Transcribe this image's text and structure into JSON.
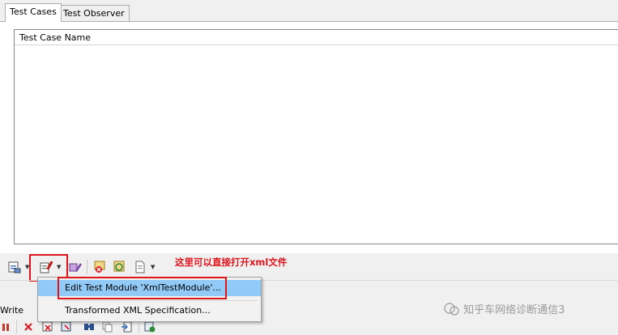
{
  "tabs": [
    {
      "label": "Test Cases",
      "active": true
    },
    {
      "label": "Test Observer",
      "active": false
    }
  ],
  "list": {
    "column_header": "Test Case Name"
  },
  "annotation": "这里可以直接打开xml文件",
  "context_menu": {
    "items": [
      {
        "label": "Edit Test Module 'XmlTestModule'...",
        "highlighted": true
      },
      {
        "label": "Transformed XML Specification...",
        "highlighted": false
      }
    ]
  },
  "bottom_panel": {
    "label": "Write"
  },
  "watermark": "知乎车网络诊断通信3",
  "colors": {
    "highlight": "#91c9f7",
    "annotation_red": "#e0151b",
    "border": "#828790"
  },
  "toolbar_icons": [
    "test-module-icon",
    "edit-xml-icon",
    "brush-icon",
    "error-report-icon",
    "refresh-report-icon",
    "document-icon"
  ],
  "bottom_toolbar_icons": [
    "pause-icon",
    "stop-icon",
    "delete-error-icon",
    "filter-icon",
    "find-icon",
    "copy-icon",
    "export-icon",
    "options-icon"
  ]
}
